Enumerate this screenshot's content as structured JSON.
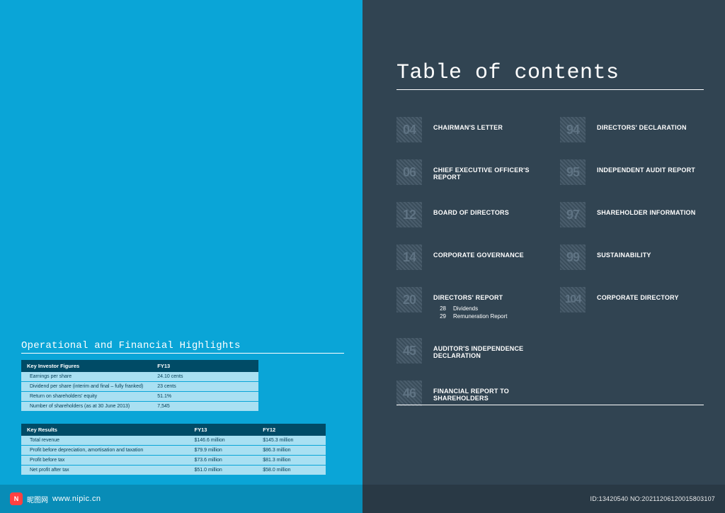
{
  "left": {
    "section_title": "Operational and Financial Highlights",
    "table1": {
      "headers": [
        "Key Investor Figures",
        "FY13"
      ],
      "rows": [
        [
          "Earnings per share",
          "24.10 cents"
        ],
        [
          "Dividend per share (interim and final – fully franked)",
          "23 cents"
        ],
        [
          "Return on shareholders' equity",
          "51.1%"
        ],
        [
          "Number of shareholders (as at 30 June 2013)",
          "7,545"
        ]
      ]
    },
    "table2": {
      "headers": [
        "Key Results",
        "FY13",
        "FY12"
      ],
      "rows": [
        [
          "Total revenue",
          "$146.6 million",
          "$145.3 million"
        ],
        [
          "Profit before depreciation, amortisation and taxation",
          "$79.9 million",
          "$86.3 million"
        ],
        [
          "Profit before tax",
          "$73.6 million",
          "$81.3 million"
        ],
        [
          "Net profit after tax",
          "$51.0 million",
          "$58.0 million"
        ]
      ]
    }
  },
  "right": {
    "title": "Table of contents",
    "col1": [
      {
        "page": "04",
        "label": "CHAIRMAN'S LETTER"
      },
      {
        "page": "06",
        "label": "CHIEF EXECUTIVE OFFICER'S REPORT"
      },
      {
        "page": "12",
        "label": "BOARD OF DIRECTORS"
      },
      {
        "page": "14",
        "label": "CORPORATE GOVERNANCE"
      },
      {
        "page": "20",
        "label": "DIRECTORS' REPORT",
        "subs": [
          {
            "pg": "28",
            "t": "Dividends"
          },
          {
            "pg": "29",
            "t": "Remuneration Report"
          }
        ]
      },
      {
        "page": "45",
        "label": "AUDITOR'S INDEPENDENCE DECLARATION"
      },
      {
        "page": "46",
        "label": "FINANCIAL REPORT TO SHAREHOLDERS"
      }
    ],
    "col2": [
      {
        "page": "94",
        "label": "DIRECTORS' DECLARATION"
      },
      {
        "page": "95",
        "label": "INDEPENDENT AUDIT REPORT"
      },
      {
        "page": "97",
        "label": "SHAREHOLDER INFORMATION"
      },
      {
        "page": "99",
        "label": "SUSTAINABILITY"
      },
      {
        "page": "104",
        "label": "CORPORATE DIRECTORY"
      }
    ]
  },
  "footer": {
    "brand_text": "昵图网",
    "site": "www.nipic.cn",
    "meta": "ID:13420540  NO:20211206120015803107"
  }
}
